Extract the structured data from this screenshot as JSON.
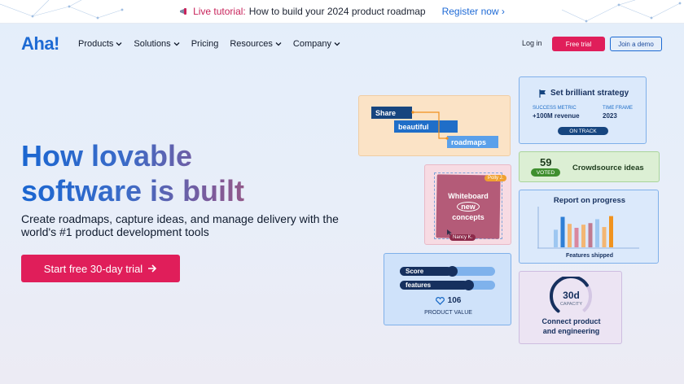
{
  "announcement": {
    "live_label": "Live tutorial:",
    "topic": "How to build your 2024 product roadmap",
    "register": "Register now ›"
  },
  "nav": {
    "logo": "Aha!",
    "menu": [
      "Products",
      "Solutions",
      "Pricing",
      "Resources",
      "Company"
    ],
    "login": "Log in",
    "free_trial": "Free trial",
    "join_demo": "Join a demo"
  },
  "hero": {
    "headline_line1": "How lovable",
    "headline_line2": "software is built",
    "subtext": "Create roadmaps, capture ideas, and manage delivery with the world's #1 product development tools",
    "cta": "Start free 30-day trial"
  },
  "cards": {
    "roadmap": {
      "bars": [
        "Share",
        "beautiful",
        "roadmaps"
      ]
    },
    "strategy": {
      "title": "Set brilliant strategy",
      "metric_label": "SUCCESS METRIC",
      "metric_value": "+100M revenue",
      "timeframe_label": "TIME FRAME",
      "timeframe_value": "2023",
      "status": "ON TRACK"
    },
    "crowdsource": {
      "count": "59",
      "badge": "VOTED",
      "title": "Crowdsource ideas"
    },
    "whiteboard": {
      "line1": "Whiteboard",
      "line2": "new",
      "line3": "concepts",
      "user1": "Polly J.",
      "user2": "Nancy K."
    },
    "progress": {
      "title": "Report on progress",
      "caption": "Features shipped",
      "bars": [
        0.45,
        0.78,
        0.6,
        0.5,
        0.58,
        0.62,
        0.72,
        0.52,
        0.8
      ]
    },
    "score": {
      "label1": "Score",
      "label2": "features",
      "slider1": 0.55,
      "slider2": 0.72,
      "value": "106",
      "caption": "PRODUCT VALUE"
    },
    "capacity": {
      "value": "30d",
      "unit": "CAPACITY",
      "line1": "Connect product",
      "line2": "and engineering",
      "fill": 0.7
    }
  },
  "colors": {
    "brand_blue": "#1d6ad3",
    "brand_pink": "#e01e5a"
  }
}
